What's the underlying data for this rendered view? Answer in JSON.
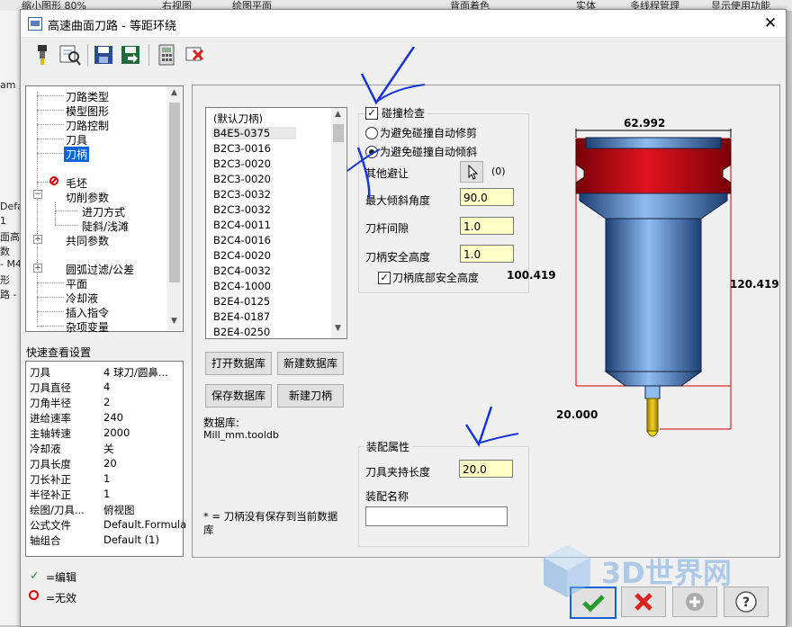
{
  "background_app": {
    "top_items": [
      "缩小图形 80%",
      "右视图",
      "绘图平面",
      "背面着色",
      "实体",
      "多线程管理",
      "显示使用功能"
    ],
    "left_fragments": [
      "am 刀",
      "Defa",
      "1",
      "面高",
      "数",
      "- M4",
      "形",
      "路 -"
    ]
  },
  "dialog": {
    "title": "高速曲面刀路 - 等距环绕",
    "close_label": "✕"
  },
  "toolbar": {
    "icons": [
      "tool-icon",
      "preview-icon",
      "save-icon",
      "export-icon",
      "calculator-icon",
      "delete-icon"
    ]
  },
  "tree": {
    "items": [
      {
        "label": "刀路类型"
      },
      {
        "label": "模型图形"
      },
      {
        "label": "刀路控制"
      },
      {
        "label": "刀具"
      },
      {
        "label": "刀柄",
        "selected": true
      },
      {
        "label": "毛坯"
      },
      {
        "label": "切削参数"
      },
      {
        "label": "进刀方式"
      },
      {
        "label": "陡斜/浅滩"
      },
      {
        "label": "共同参数"
      },
      {
        "label": "圆弧过滤/公差"
      },
      {
        "label": "平面"
      },
      {
        "label": "冷却液"
      },
      {
        "label": "插入指令"
      },
      {
        "label": "杂项变量"
      }
    ]
  },
  "quick_view": {
    "title": "快速查看设置",
    "rows": [
      {
        "k": "刀具",
        "v": "4 球刀/圆鼻..."
      },
      {
        "k": "刀具直径",
        "v": "4"
      },
      {
        "k": "刀角半径",
        "v": "2"
      },
      {
        "k": "进给速率",
        "v": "240"
      },
      {
        "k": "主轴转速",
        "v": "2000"
      },
      {
        "k": "冷却液",
        "v": "关"
      },
      {
        "k": "刀具长度",
        "v": "20"
      },
      {
        "k": "刀长补正",
        "v": "1"
      },
      {
        "k": "半径补正",
        "v": "1"
      },
      {
        "k": "绘图/刀具...",
        "v": "俯视图"
      },
      {
        "k": "公式文件",
        "v": "Default.Formula"
      },
      {
        "k": "轴组合",
        "v": "Default (1)"
      }
    ]
  },
  "legend": {
    "edit": "=编辑",
    "invalid": "=无效"
  },
  "holder_list": {
    "items": [
      "(默认刀柄)",
      "B4E5-0375",
      "B2C3-0016",
      "B2C3-0020",
      "B2C3-0020",
      "B2C3-0032",
      "B2C3-0032",
      "B2C4-0011",
      "B2C4-0016",
      "B2C4-0020",
      "B2C4-0032",
      "B2C4-1000",
      "B2E4-0125",
      "B2E4-0187",
      "B2E4-0250"
    ],
    "selected_index": 1
  },
  "buttons": {
    "open_db": "打开数据库",
    "new_db": "新建数据库",
    "save_db": "保存数据库",
    "new_holder": "新建刀柄"
  },
  "database": {
    "label": "数据库:",
    "file": "Mill_mm.tooldb",
    "note": "* = 刀柄没有保存到当前数据库"
  },
  "collision": {
    "check_label": "碰撞检查",
    "checked": true,
    "option1": "为避免碰撞自动修剪",
    "option2": "为避免碰撞自动倾斜",
    "selected_option": 2,
    "other_avoid": "其他避让",
    "other_count": "(0)",
    "max_tilt_label": "最大倾斜角度",
    "max_tilt_value": "90.0",
    "shank_clear_label": "刀杆间隙",
    "shank_clear_value": "1.0",
    "holder_safe_label": "刀柄安全高度",
    "holder_safe_value": "1.0",
    "holder_bottom_label": "刀柄底部安全高度",
    "holder_bottom_checked": true
  },
  "assembly": {
    "title": "装配属性",
    "grip_label": "刀具夹持长度",
    "grip_value": "20.0",
    "name_label": "装配名称",
    "name_value": ""
  },
  "diagram": {
    "dim_top": "62.992",
    "dim_left": "100.419",
    "dim_right": "120.419",
    "dim_bottom": "20.000",
    "colors": {
      "holder_red": "#e0141e",
      "body_blue": "#4f86c6",
      "tip_yellow": "#f2d21f"
    }
  },
  "footer": {
    "icons": [
      "ok-check-icon",
      "cancel-x-icon",
      "add-icon",
      "help-icon"
    ]
  },
  "watermark": {
    "text": "3D世界网"
  }
}
